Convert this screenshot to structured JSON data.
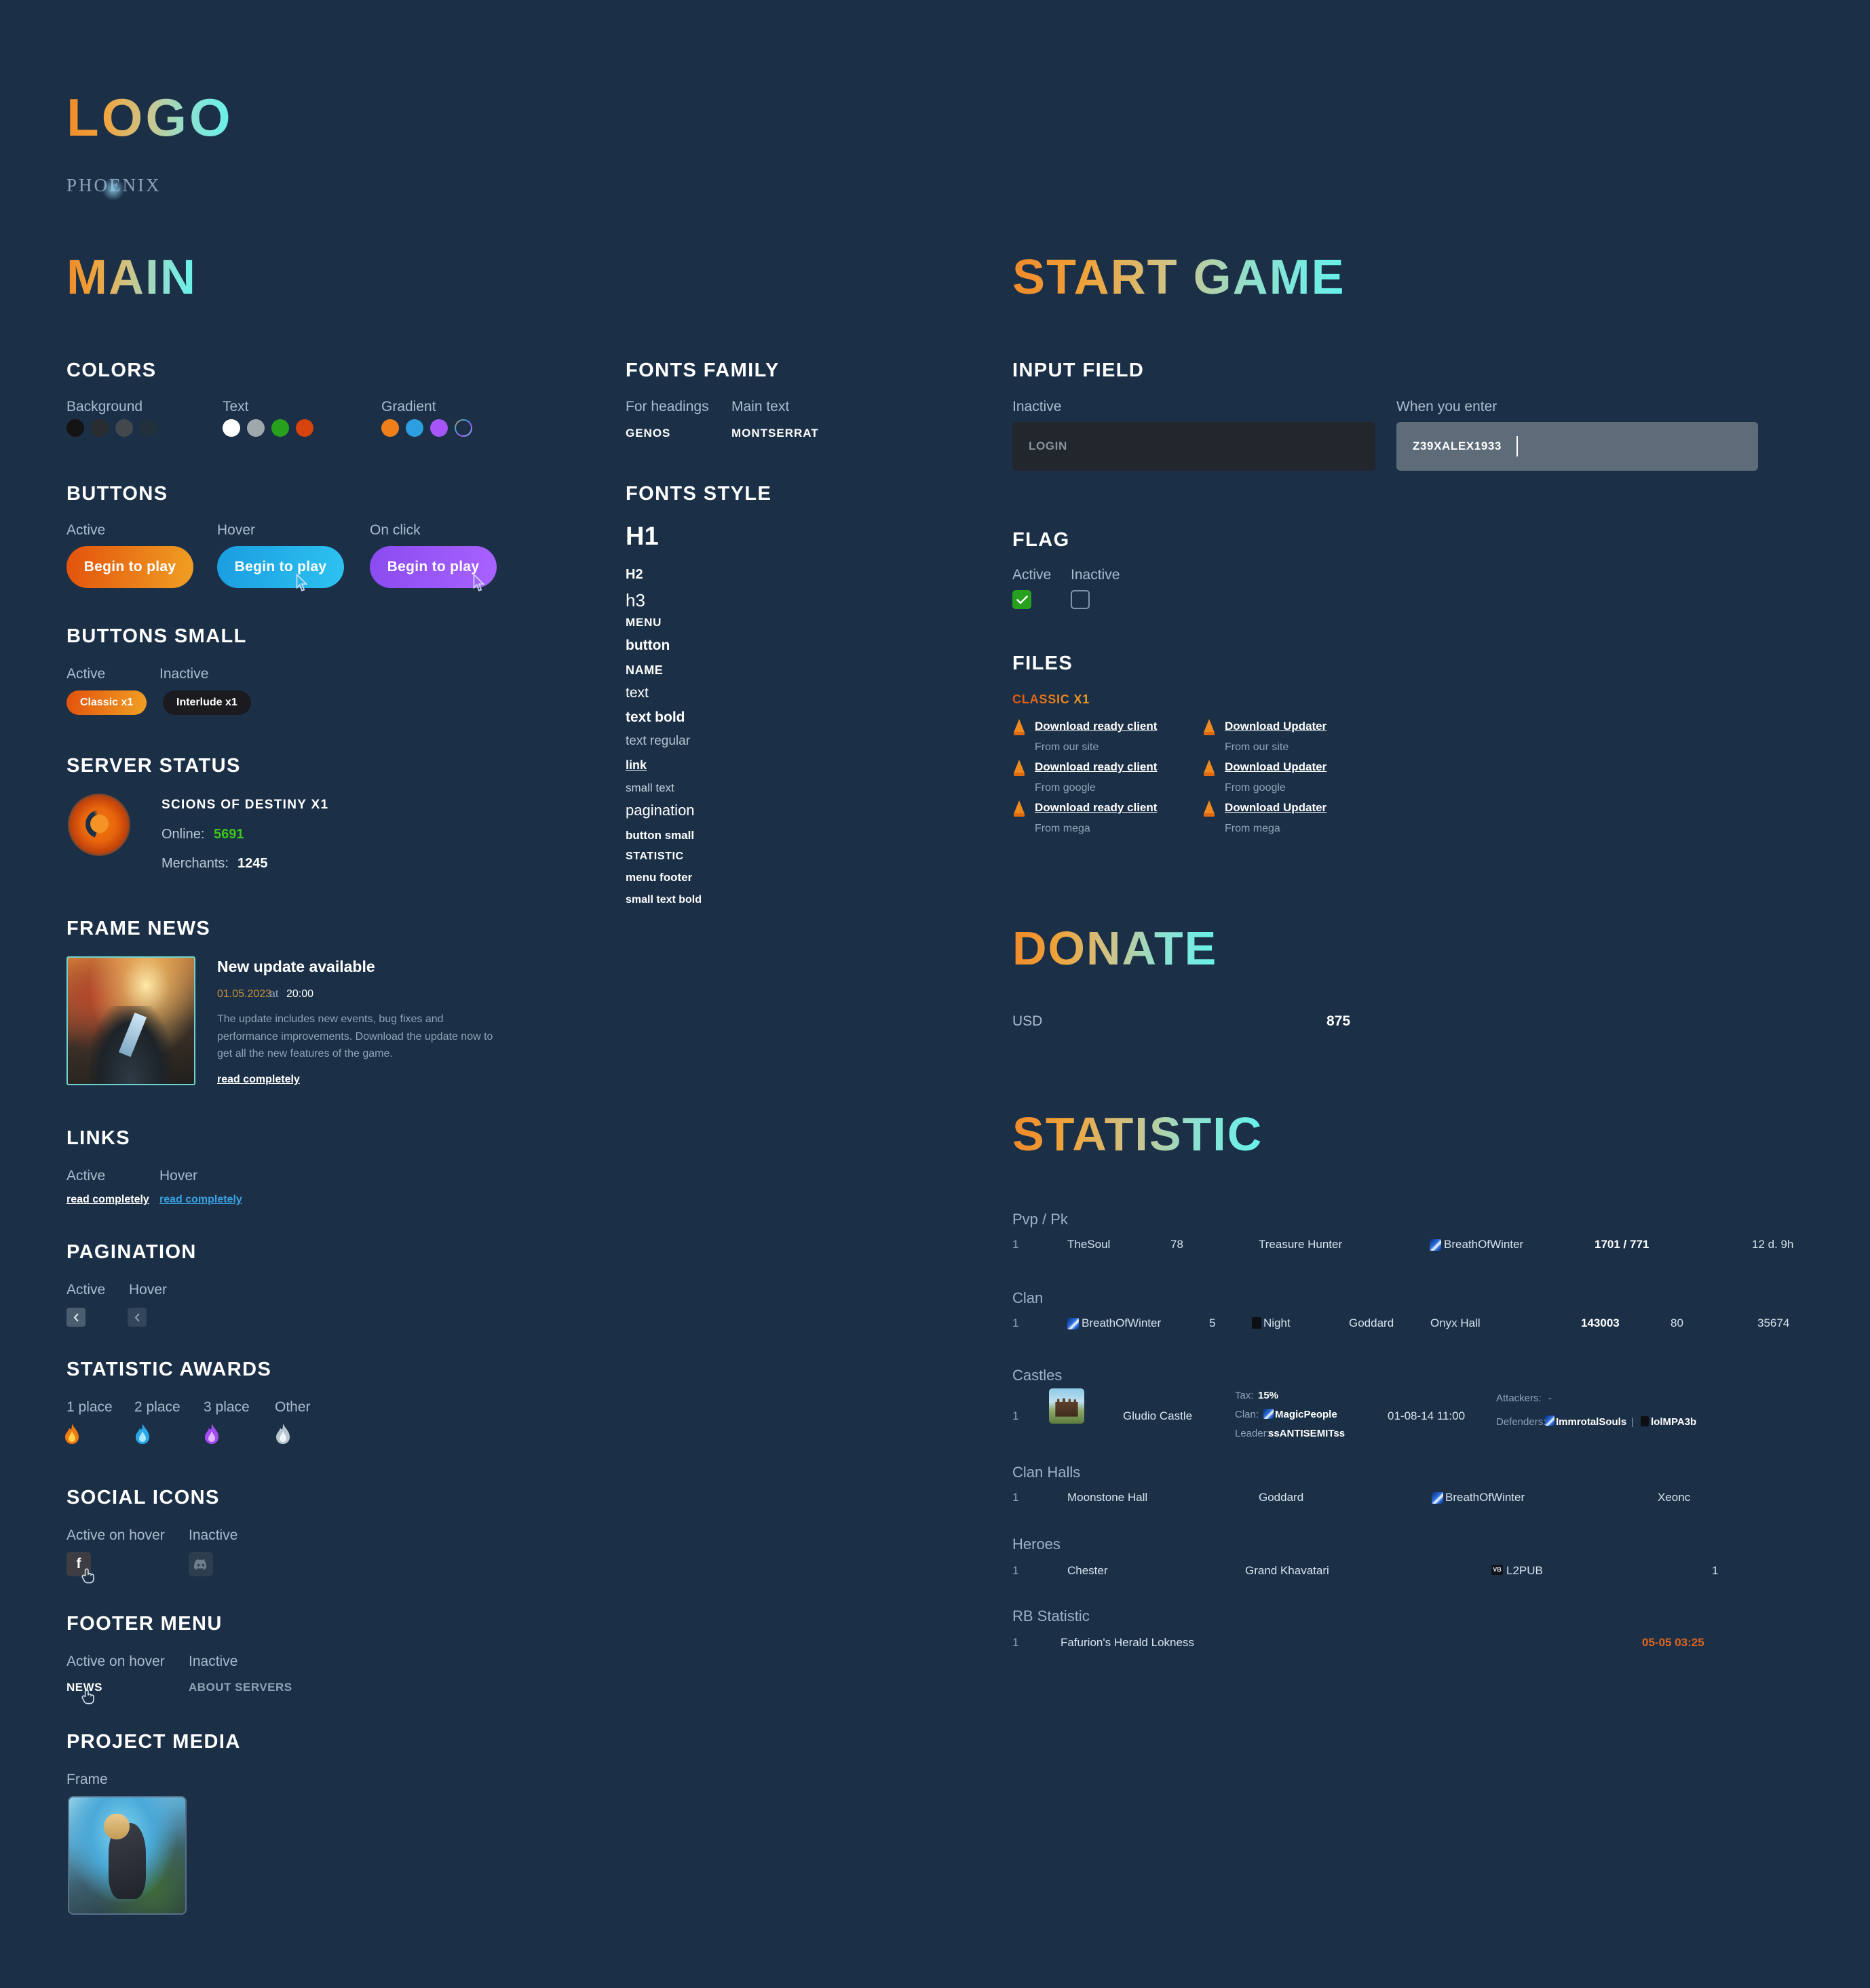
{
  "brand": {
    "logo": "LOGO",
    "wordmark": "PHOENIX"
  },
  "sections": {
    "main": "MAIN",
    "start_game": "START GAME",
    "donate": "DONATE",
    "statistic": "STATISTIC"
  },
  "colors_block": {
    "heading": "COLORS",
    "groups": [
      {
        "label": "Background",
        "swatches": [
          "#141414",
          "#2a2d30",
          "#43484c",
          "#22303c"
        ]
      },
      {
        "label": "Text",
        "swatches": [
          "#ffffff",
          "#9fa9ad",
          "#27a01e",
          "#d6430c"
        ]
      },
      {
        "label": "Gradient",
        "swatches": [
          "#ef7f18",
          "#2b9fe0",
          "#a855f7",
          "ring"
        ]
      }
    ]
  },
  "buttons": {
    "heading": "BUTTONS",
    "states": [
      "Active",
      "Hover",
      "On click"
    ],
    "label": "Begin to play"
  },
  "buttons_small": {
    "heading": "BUTTONS SMALL",
    "states": [
      "Active",
      "Inactive"
    ],
    "active_label": "Classic x1",
    "inactive_label": "Interlude x1"
  },
  "server_status": {
    "heading": "SERVER STATUS",
    "name": "SCIONS OF DESTINY X1",
    "online_label": "Online:",
    "online_value": "5691",
    "merchants_label": "Merchants:",
    "merchants_value": "1245",
    "online_color": "#3ec41a"
  },
  "frame_news": {
    "heading": "FRAME NEWS",
    "title": "New update available",
    "date": "01.05.2023",
    "at": "at",
    "time": "20:00",
    "body": "The update includes new events, bug fixes and performance improvements. Download the update now to get all the new features of the game.",
    "link": "read completely"
  },
  "links": {
    "heading": "LINKS",
    "states": [
      "Active",
      "Hover"
    ],
    "label": "read completely"
  },
  "pagination": {
    "heading": "PAGINATION",
    "states": [
      "Active",
      "Hover"
    ],
    "glyph": "chevron-left"
  },
  "statistic_awards": {
    "heading": "STATISTIC AWARDS",
    "places": [
      "1 place",
      "2 place",
      "3 place",
      "Other"
    ],
    "flame_colors": [
      "#f07a12",
      "#29a8e8",
      "#a24bf0",
      "#b9c6d0"
    ]
  },
  "social_icons": {
    "heading": "SOCIAL ICONS",
    "states": [
      "Active on hover",
      "Inactive"
    ],
    "active_icon": "facebook-icon",
    "inactive_icon": "discord-icon"
  },
  "footer_menu": {
    "heading": "FOOTER MENU",
    "states": [
      "Active on hover",
      "Inactive"
    ],
    "active_label": "NEWS",
    "inactive_label": "ABOUT SERVERS"
  },
  "project_media": {
    "heading": "PROJECT MEDIA",
    "label": "Frame"
  },
  "fonts_family": {
    "heading": "FONTS FAMILY",
    "headings_label": "For headings",
    "headings_font": "GENOS",
    "main_label": "Main text",
    "main_font": "MONTSERRAT"
  },
  "fonts_style": {
    "heading": "FONTS STYLE",
    "items": [
      "H1",
      "H2",
      "h3",
      "MENU",
      "button",
      "NAME",
      "text",
      "text bold",
      "text regular",
      "link",
      "small text",
      "pagination",
      "button small",
      "STATISTIC",
      "menu footer",
      "small text bold"
    ]
  },
  "input_field": {
    "heading": "INPUT FIELD",
    "inactive_label": "Inactive",
    "inactive_value": "LOGIN",
    "active_label": "When you enter",
    "active_value": "Z39XALEX1933"
  },
  "flag": {
    "heading": "FLAG",
    "states": [
      "Active",
      "Inactive"
    ],
    "check_glyph": "check-icon"
  },
  "files": {
    "heading": "FILES",
    "group": "CLASSIC X1",
    "left_column": [
      {
        "link": "Download ready client",
        "source": "From our site"
      },
      {
        "link": "Download ready client",
        "source": "From google"
      },
      {
        "link": "Download ready client",
        "source": "From mega"
      }
    ],
    "right_column": [
      {
        "link": "Download Updater",
        "source": "From our site"
      },
      {
        "link": "Download Updater",
        "source": "From google"
      },
      {
        "link": "Download Updater",
        "source": "From mega"
      }
    ]
  },
  "donate": {
    "currency": "USD",
    "amount": "875"
  },
  "statistic": {
    "groups": [
      {
        "name": "Pvp / Pk",
        "rows": [
          {
            "cells": [
              "1",
              "TheSoul",
              "78",
              "Treasure Hunter",
              "BreathOfWinter",
              "1701 / 771",
              "12 d. 9h"
            ]
          }
        ]
      },
      {
        "name": "Clan",
        "rows": [
          {
            "cells": [
              "1",
              "BreathOfWinter",
              "5",
              "Night",
              "Goddard",
              "Onyx Hall",
              "143003",
              "80",
              "35674"
            ]
          }
        ]
      },
      {
        "name": "Castles",
        "rows": [
          {
            "rank": "1",
            "castle": "Gludio Castle",
            "tax_label": "Tax:",
            "tax_value": "15%",
            "clan_label": "Clan:",
            "clan_value": "MagicPeople",
            "leader_label": "Leader:",
            "leader_value": "ssANTISEMITss",
            "siege": "01-08-14 11:00",
            "attackers_label": "Attackers:",
            "attackers_value": "-",
            "defenders_label": "Defenders:",
            "defender_1": "ImmrotalSouls",
            "defender_sep": "|",
            "defender_2": "lolMPA3b"
          }
        ]
      },
      {
        "name": "Clan Halls",
        "rows": [
          {
            "cells": [
              "1",
              "Moonstone Hall",
              "Goddard",
              "BreathOfWinter",
              "Xeonc"
            ]
          }
        ]
      },
      {
        "name": "Heroes",
        "rows": [
          {
            "cells": [
              "1",
              "Chester",
              "Grand Khavatari",
              "L2PUB",
              "1"
            ]
          }
        ]
      },
      {
        "name": "RB Statistic",
        "rows": [
          {
            "cells": [
              "1",
              "Fafurion's Herald Lokness",
              "05-05 03:25"
            ]
          }
        ]
      }
    ]
  }
}
